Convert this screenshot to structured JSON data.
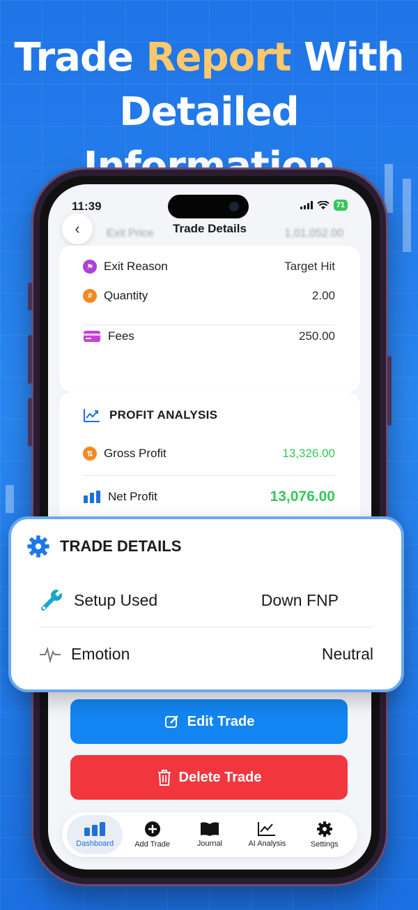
{
  "headline": {
    "line1_a": "Trade",
    "line1_accent": "Report",
    "line1_b": "With",
    "line2": "Detailed Information"
  },
  "status_bar": {
    "time": "11:39",
    "battery": "71"
  },
  "nav": {
    "title": "Trade Details",
    "back_icon": "chevron-left-icon"
  },
  "blurred_row": {
    "label": "Exit Price",
    "value": "1,01,052.00"
  },
  "trade_info": [
    {
      "label": "Exit Reason",
      "value": "Target Hit",
      "icon": "flag-icon",
      "color": "#b040d8"
    },
    {
      "label": "Quantity",
      "value": "2.00",
      "icon": "hash-icon",
      "color": "#f08a24"
    },
    {
      "label": "Fees",
      "value": "250.00",
      "icon": "card-icon",
      "color": "#c840d8"
    }
  ],
  "profit_analysis": {
    "title": "PROFIT ANALYSIS",
    "gross_label": "Gross Profit",
    "gross_value": "13,326.00",
    "net_label": "Net Profit",
    "net_value": "13,076.00",
    "positive_color": "#34c759"
  },
  "trade_details": {
    "title": "TRADE DETAILS",
    "setup_label": "Setup Used",
    "setup_value": "Down FNP",
    "emotion_label": "Emotion",
    "emotion_value": "Neutral"
  },
  "actions": {
    "edit": "Edit Trade",
    "delete": "Delete Trade"
  },
  "tabs": [
    {
      "label": "Dashboard",
      "icon": "bar-chart-icon",
      "active": true
    },
    {
      "label": "Add Trade",
      "icon": "plus-circle-icon",
      "active": false
    },
    {
      "label": "Journal",
      "icon": "book-icon",
      "active": false
    },
    {
      "label": "AI Analysis",
      "icon": "trend-chart-icon",
      "active": false
    },
    {
      "label": "Settings",
      "icon": "gear-icon",
      "active": false
    }
  ],
  "colors": {
    "accent": "#1385f2",
    "danger": "#f2363e",
    "headline_accent": "#ffc86a"
  }
}
